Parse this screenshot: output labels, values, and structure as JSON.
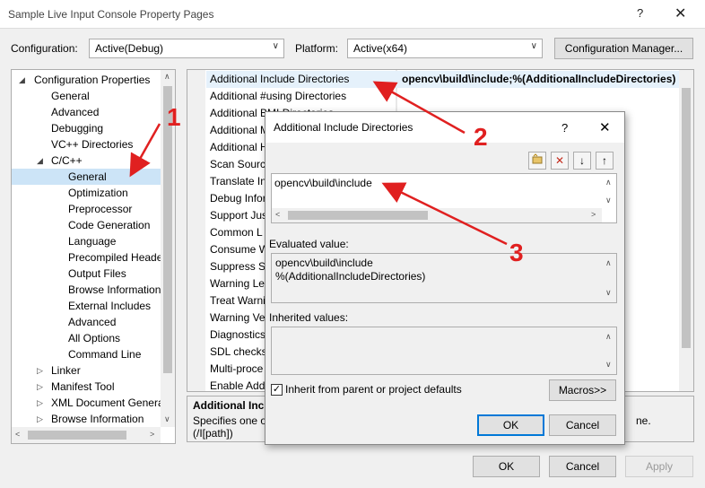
{
  "window": {
    "title": "Sample Live Input Console Property Pages",
    "help": "?",
    "close": "✕"
  },
  "toolbar": {
    "configuration_label": "Configuration:",
    "configuration_value": "Active(Debug)",
    "platform_label": "Platform:",
    "platform_value": "Active(x64)",
    "configuration_manager": "Configuration Manager..."
  },
  "tree": {
    "items": [
      {
        "label": "Configuration Properties",
        "expander": "◢"
      },
      {
        "label": "General"
      },
      {
        "label": "Advanced"
      },
      {
        "label": "Debugging"
      },
      {
        "label": "VC++ Directories"
      },
      {
        "label": "C/C++",
        "expander": "◢"
      },
      {
        "label": "General"
      },
      {
        "label": "Optimization"
      },
      {
        "label": "Preprocessor"
      },
      {
        "label": "Code Generation"
      },
      {
        "label": "Language"
      },
      {
        "label": "Precompiled Heade"
      },
      {
        "label": "Output Files"
      },
      {
        "label": "Browse Information"
      },
      {
        "label": "External Includes"
      },
      {
        "label": "Advanced"
      },
      {
        "label": "All Options"
      },
      {
        "label": "Command Line"
      },
      {
        "label": "Linker",
        "expander": "▷"
      },
      {
        "label": "Manifest Tool",
        "expander": "▷"
      },
      {
        "label": "XML Document Genera",
        "expander": "▷"
      },
      {
        "label": "Browse Information",
        "expander": "▷"
      }
    ]
  },
  "grid": {
    "rows": [
      "Additional Include Directories",
      "Additional #using Directories",
      "Additional BMI Directories",
      "Additional M",
      "Additional H",
      "Scan Source",
      "Translate Inc",
      "Debug Infor",
      "Support Jus",
      "Common L",
      "Consume W",
      "Suppress St",
      "Warning Lev",
      "Treat Warnin",
      "Warning Ve",
      "Diagnostics",
      "SDL checks",
      "Multi-proce",
      "Enable Addi"
    ],
    "selected_value": "opencv\\build\\include;%(AdditionalIncludeDirectories)"
  },
  "description": {
    "title": "Additional Inclu",
    "line1": "Specifies one or",
    "line1_tail": "ne.",
    "line2": "(/I[path])"
  },
  "dialog": {
    "title": "Additional Include Directories",
    "help": "?",
    "close": "✕",
    "editor_value": "opencv\\build\\include",
    "evaluated_label": "Evaluated value:",
    "evaluated_line1": "opencv\\build\\include",
    "evaluated_line2": "%(AdditionalIncludeDirectories)",
    "inherited_label": "Inherited values:",
    "inherit_checkbox_label": "Inherit from parent or project defaults",
    "inherit_checked": true,
    "macros_button": "Macros>>",
    "ok": "OK",
    "cancel": "Cancel"
  },
  "footer": {
    "ok": "OK",
    "cancel": "Cancel",
    "apply": "Apply"
  },
  "annotations": {
    "one": "1",
    "two": "2",
    "three": "3",
    "color": "#e02020"
  }
}
